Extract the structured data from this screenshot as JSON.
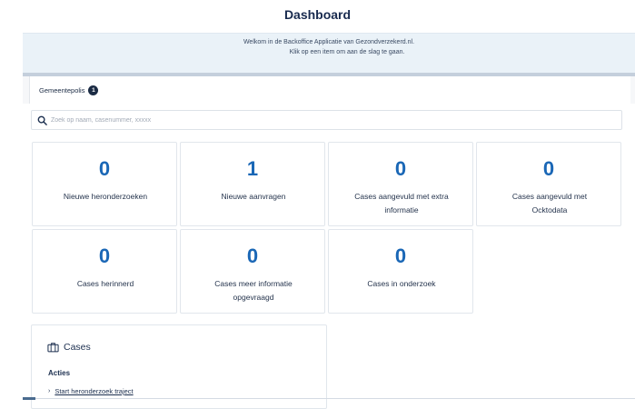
{
  "page": {
    "title": "Dashboard",
    "welcome_line1": "Welkom in de Backoffice Applicatie van Gezondverzekerd.nl.",
    "welcome_line2": "Klik op een item om aan de slag te gaan."
  },
  "tab": {
    "label": "Gemeentepolis",
    "badge": "1"
  },
  "search": {
    "placeholder": "Zoek op naam, casenummer, xxxxx"
  },
  "cards": [
    {
      "count": "0",
      "label": "Nieuwe heronderzoeken"
    },
    {
      "count": "1",
      "label": "Nieuwe aanvragen"
    },
    {
      "count": "0",
      "label": "Cases aangevuld met extra informatie"
    },
    {
      "count": "0",
      "label": "Cases aangevuld met Ocktodata"
    },
    {
      "count": "0",
      "label": "Cases herinnerd"
    },
    {
      "count": "0",
      "label": "Cases meer informatie opgevraagd"
    },
    {
      "count": "0",
      "label": "Cases in onderzoek"
    }
  ],
  "cases": {
    "icon": "briefcase-icon",
    "title": "Cases",
    "actions_heading": "Acties",
    "actions": [
      "Start heronderzoek traject"
    ]
  },
  "colors": {
    "accent": "#1a67b6",
    "navy": "#1c2f4f",
    "banner": "#eaf2f8"
  }
}
